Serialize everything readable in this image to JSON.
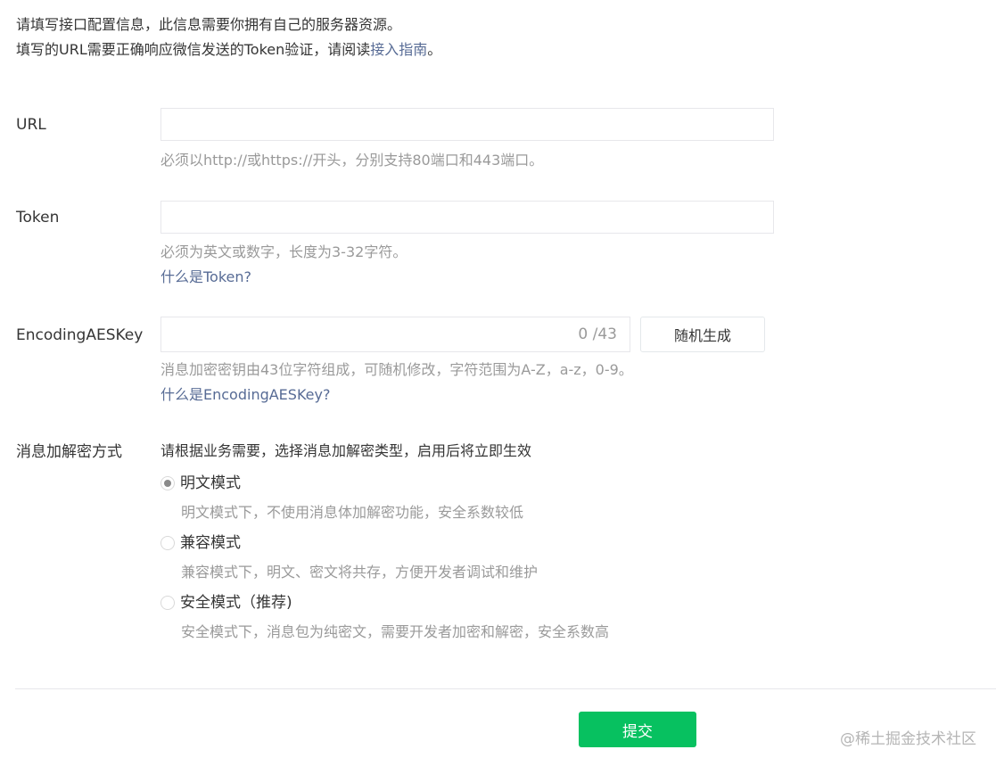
{
  "intro": {
    "line1": "请填写接口配置信息，此信息需要你拥有自己的服务器资源。",
    "line2_prefix": "填写的URL需要正确响应微信发送的Token验证，请阅读",
    "line2_link": "接入指南",
    "line2_suffix": "。"
  },
  "url": {
    "label": "URL",
    "value": "",
    "placeholder": "",
    "hint": "必须以http://或https://开头，分别支持80端口和443端口。"
  },
  "token": {
    "label": "Token",
    "value": "",
    "placeholder": "",
    "hint": "必须为英文或数字，长度为3-32字符。",
    "help_link": "什么是Token?"
  },
  "aes": {
    "label": "EncodingAESKey",
    "value": "",
    "placeholder": "",
    "counter": "0 /43",
    "generate_button": "随机生成",
    "hint": "消息加密密钥由43位字符组成，可随机修改，字符范围为A-Z，a-z，0-9。",
    "help_link": "什么是EncodingAESKey?"
  },
  "encryption": {
    "label": "消息加解密方式",
    "description": "请根据业务需要，选择消息加解密类型，启用后将立即生效",
    "options": [
      {
        "label": "明文模式",
        "hint": "明文模式下，不使用消息体加解密功能，安全系数较低",
        "checked": true
      },
      {
        "label": "兼容模式",
        "hint": "兼容模式下，明文、密文将共存，方便开发者调试和维护",
        "checked": false
      },
      {
        "label": "安全模式（推荐)",
        "hint": "安全模式下，消息包为纯密文，需要开发者加密和解密，安全系数高",
        "checked": false
      }
    ]
  },
  "submit_button": "提交",
  "watermark": "@稀土掘金技术社区",
  "colors": {
    "primary": "#07c160",
    "link": "#576b95",
    "hint": "#9a9a9a",
    "text": "#353535"
  }
}
